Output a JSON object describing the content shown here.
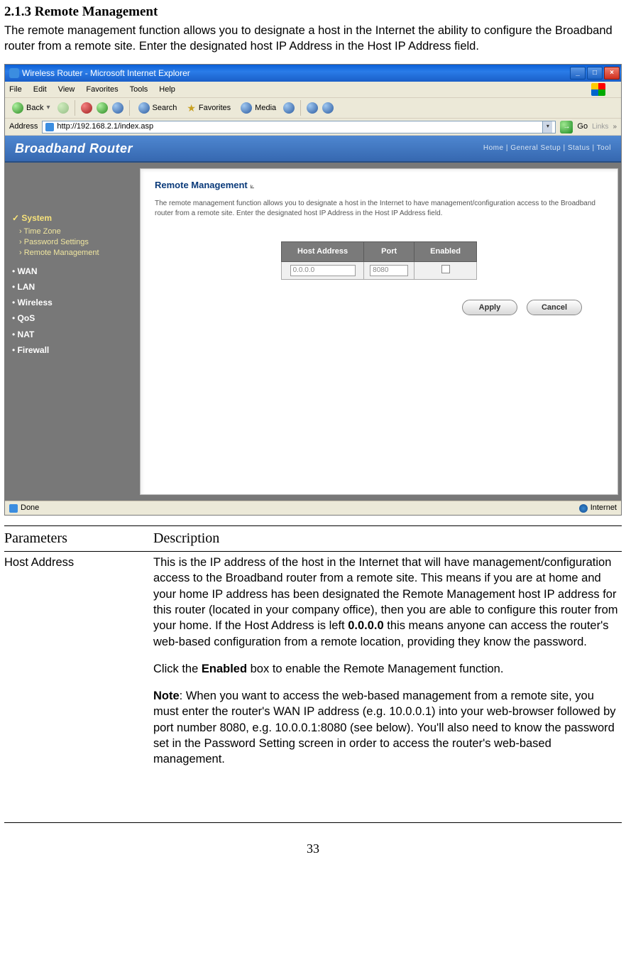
{
  "page": {
    "section_title": "2.1.3 Remote Management",
    "intro": "The remote management function allows you to designate a host in the Internet the ability to configure the Broadband router from a remote site. Enter the designated host IP Address in the Host IP Address field.",
    "page_number": "33"
  },
  "screenshot": {
    "title": "Wireless Router - Microsoft Internet Explorer",
    "menu": {
      "file": "File",
      "edit": "Edit",
      "view": "View",
      "favorites": "Favorites",
      "tools": "Tools",
      "help": "Help"
    },
    "toolbar": {
      "back": "Back",
      "search": "Search",
      "favorites": "Favorites",
      "media": "Media"
    },
    "address": {
      "label": "Address",
      "url": "http://192.168.2.1/index.asp",
      "go": "Go",
      "links": "Links"
    },
    "router_header": {
      "title": "Broadband Router",
      "toplinks": "Home | General Setup | Status | Tool"
    },
    "sidebar": {
      "system": "System",
      "subs": {
        "timezone": "Time Zone",
        "password": "Password Settings",
        "remote": "Remote Management"
      },
      "items": {
        "wan": "WAN",
        "lan": "LAN",
        "wireless": "Wireless",
        "qos": "QoS",
        "nat": "NAT",
        "firewall": "Firewall"
      }
    },
    "content": {
      "title": "Remote Management",
      "desc": "The remote management function allows you to designate a host in the Internet to have management/configuration access to the Broadband router from a remote site. Enter the designated host IP Address in the Host IP Address field.",
      "headers": {
        "host": "Host Address",
        "port": "Port",
        "enabled": "Enabled"
      },
      "values": {
        "host": "0.0.0.0",
        "port": "8080"
      },
      "buttons": {
        "apply": "Apply",
        "cancel": "Cancel"
      }
    },
    "status": {
      "done": "Done",
      "zone": "Internet"
    }
  },
  "params_table": {
    "col_param": "Parameters",
    "col_desc": "Description",
    "row1_param": "Host Address",
    "row1_desc": {
      "p1a": "This is the IP address of the ",
      "p1b": "host in the Internet that will have management/configuration access to the Broadband router from a remote site. This means if you are at home and your home IP address has been designated the Remote Management host IP address for this router (located in your company office), then you are able to configure this router from your home. If the Host Address is left ",
      "bold1": "0.0.0.0",
      "p1c": " this means anyone can access the router's web-based configuration from a remote location, providing they know the password.",
      "p2a": "Click the ",
      "bold2": "Enabled",
      "p2b": " box to enable the Remote Management function.",
      "p3a": "Note",
      "p3b": ": When you want to access the web-based management from a remote site, you must enter the router's WAN IP address (e.g. 10.0.0.1) into your web-browser followed by port number 8080, e.g. 10.0.0.1:8080 (see below). You'll also need to know the password set in the Password Setting screen in order to access the router's web-based management."
    }
  }
}
